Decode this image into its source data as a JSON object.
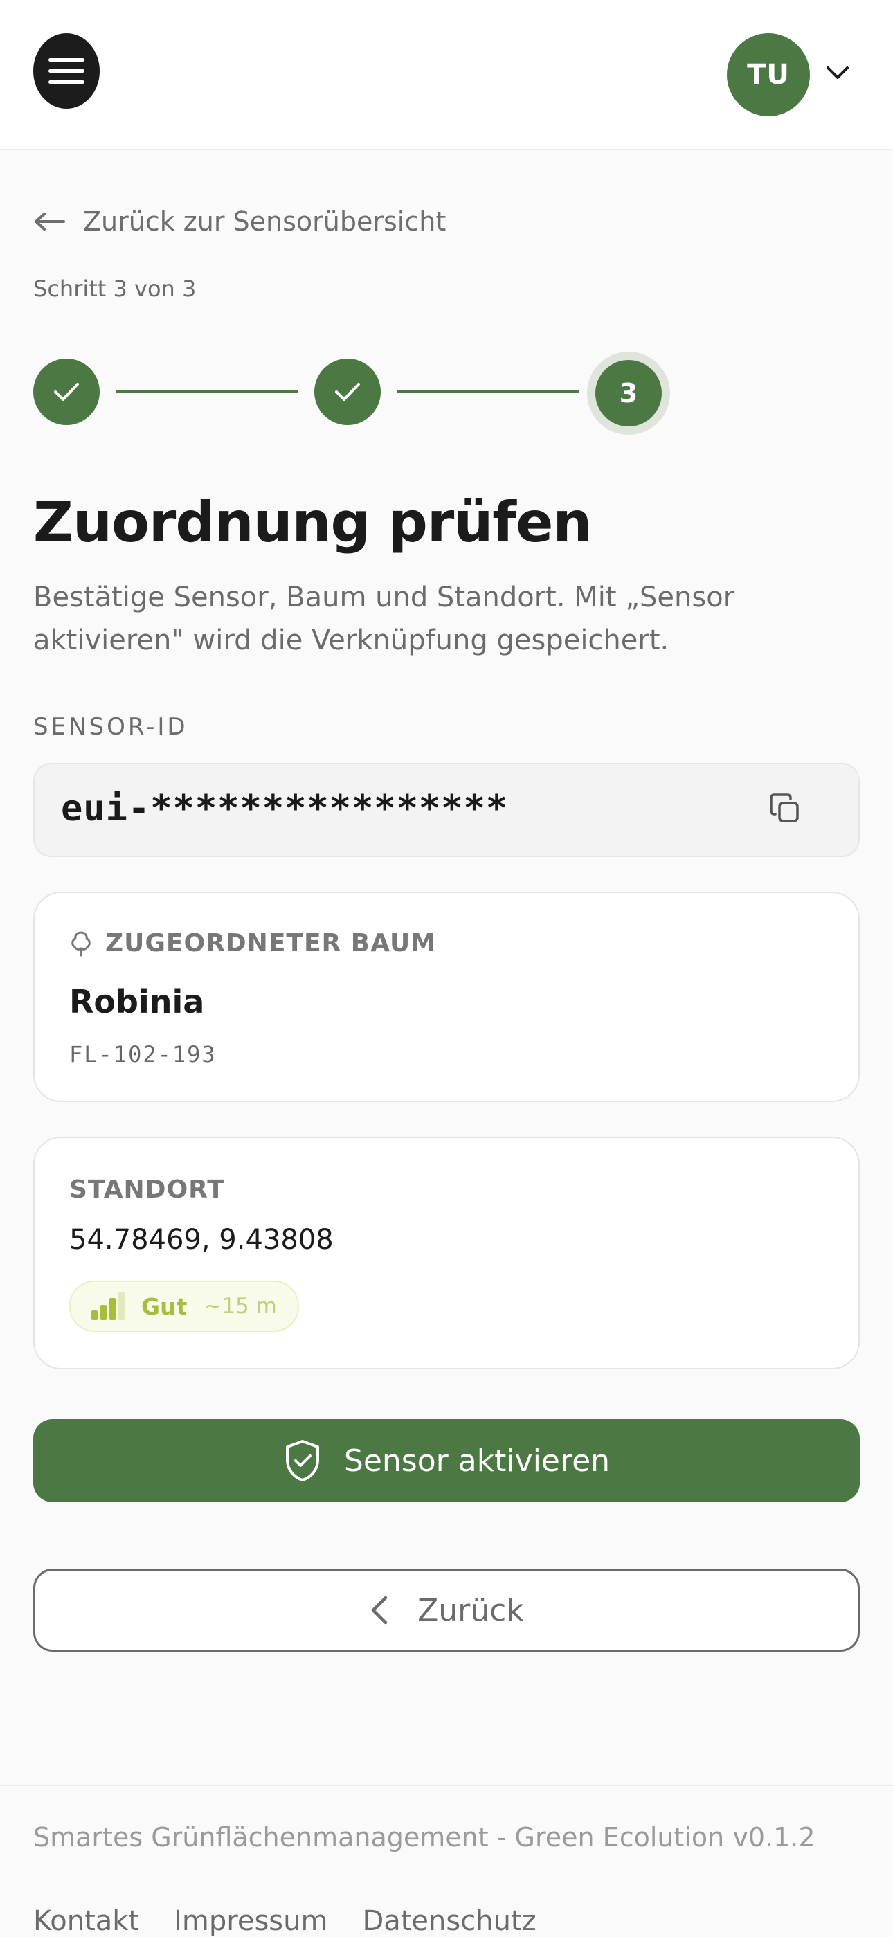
{
  "header": {
    "avatar_initials": "TU"
  },
  "nav": {
    "back_link_label": "Zurück zur Sensorübersicht"
  },
  "stepper": {
    "step_text": "Schritt 3 von 3",
    "current_step": "3",
    "total_steps": 3,
    "completed_steps": 2
  },
  "page": {
    "title": "Zuordnung prüfen",
    "description": "Bestätige Sensor, Baum und Standort. Mit „Sensor aktivieren\" wird die Verknüpfung gespeichert."
  },
  "sensor": {
    "label": "SENSOR-ID",
    "value": "eui-****************"
  },
  "tree_card": {
    "heading": "ZUGEORDNETER BAUM",
    "name": "Robinia",
    "tree_id": "FL-102-193"
  },
  "location_card": {
    "heading": "STANDORT",
    "coordinates": "54.78469, 9.43808",
    "signal_quality": "Gut",
    "accuracy": "~15 m",
    "signal_bars_active": 2,
    "signal_bars_total": 3
  },
  "actions": {
    "activate_label": "Sensor aktivieren",
    "back_label": "Zurück"
  },
  "footer": {
    "text": "Smartes Grünflächenmanagement - Green Ecolution v0.1.2",
    "links": [
      "Kontakt",
      "Impressum",
      "Datenschutz"
    ]
  },
  "colors": {
    "primary": "#4b7843",
    "signal": "#a8bd3c",
    "text": "#1b1b1b",
    "muted": "#6b6b6b"
  },
  "icons": [
    "menu-icon",
    "chevron-down-icon",
    "arrow-left-icon",
    "check-icon",
    "copy-icon",
    "tree-icon",
    "signal-icon",
    "shield-check-icon",
    "chevron-left-icon"
  ]
}
